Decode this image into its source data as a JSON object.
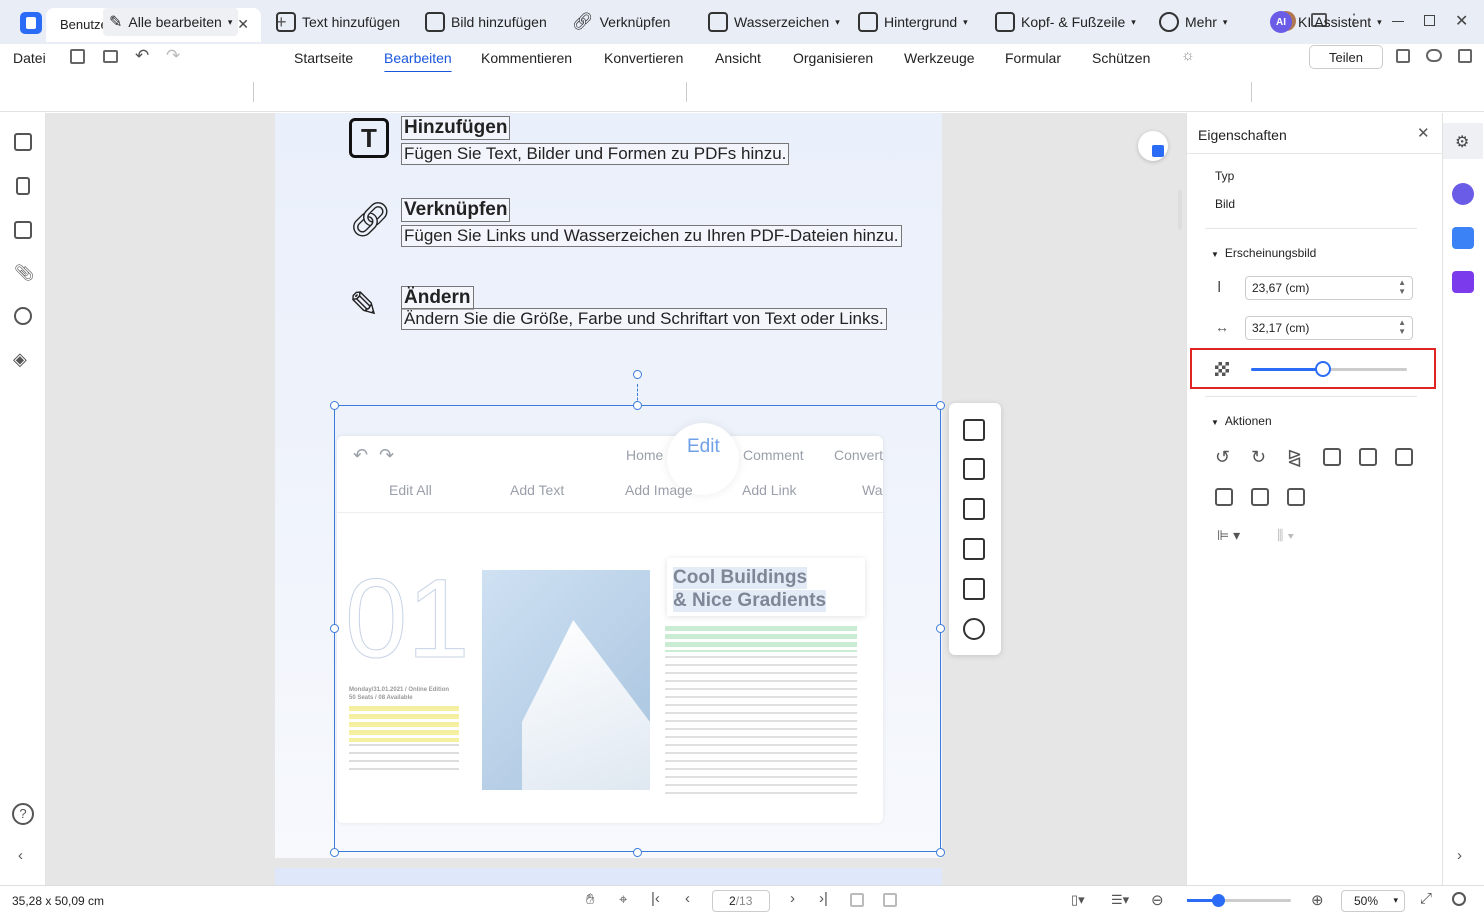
{
  "window": {
    "tab_title": "Benutzerhandbuch-win.pdf *"
  },
  "menu": {
    "file": "Datei",
    "items": [
      "Startseite",
      "Bearbeiten",
      "Kommentieren",
      "Konvertieren",
      "Ansicht",
      "Organisieren",
      "Werkzeuge",
      "Formular",
      "Schützen"
    ],
    "active": "Bearbeiten",
    "share": "Teilen"
  },
  "toolbar": {
    "edit_all": "Alle bearbeiten",
    "add_text": "Text hinzufügen",
    "add_image": "Bild hinzufügen",
    "link": "Verknüpfen",
    "watermark": "Wasserzeichen",
    "background": "Hintergrund",
    "header_footer": "Kopf- & Fußzeile",
    "more": "Mehr",
    "ai_badge": "AI",
    "ai": "KI Assistent"
  },
  "page": {
    "features": [
      {
        "title": "Hinzufügen",
        "desc": "Fügen Sie Text, Bilder und Formen zu PDFs hinzu."
      },
      {
        "title": "Verknüpfen",
        "desc": "Fügen Sie Links und Wasserzeichen zu Ihren PDF-Dateien hinzu."
      },
      {
        "title": "Ändern",
        "desc": "Ändern Sie die Größe, Farbe und Schriftart von Text oder Links."
      }
    ],
    "screenshot": {
      "tabs": [
        "Home",
        "Edit",
        "Comment",
        "Convert"
      ],
      "tools": [
        "Edit All",
        "Add Text",
        "Add Image",
        "Add Link",
        "Wa"
      ],
      "big_number": "01",
      "heading_line1": "Cool Buildings",
      "heading_line2": "& Nice Gradients",
      "date_line": "Monday/31.01.2021 / Online Edition",
      "seats_line": "50 Seats / 08 Available"
    }
  },
  "properties": {
    "title": "Eigenschaften",
    "type_label": "Typ",
    "type_value": "Bild",
    "appearance": "Erscheinungsbild",
    "height": "23,67 (cm)",
    "width": "32,17 (cm)",
    "opacity_level": 0.46,
    "actions": "Aktionen"
  },
  "status": {
    "dimensions": "35,28 x 50,09 cm",
    "page_input": "2",
    "page_total": "/13",
    "zoom_value": "50%",
    "zoom_level": 0.3
  },
  "colors": {
    "accent": "#1a56db",
    "highlight_box": "#e02424"
  }
}
